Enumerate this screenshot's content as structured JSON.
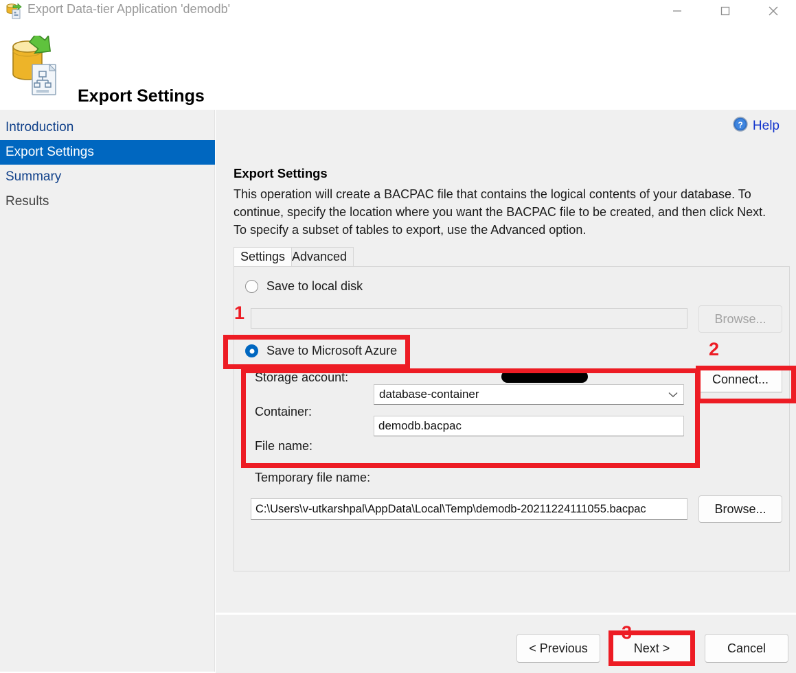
{
  "window": {
    "title": "Export Data-tier Application 'demodb'",
    "icon": "export-dac-icon",
    "controls": {
      "minimize": "minimize-icon",
      "maximize": "maximize-icon",
      "close": "close-icon"
    }
  },
  "header": {
    "title": "Export Settings",
    "icon": "database-export-icon"
  },
  "sidebar": {
    "items": [
      {
        "label": "Introduction",
        "state": "link"
      },
      {
        "label": "Export Settings",
        "state": "active"
      },
      {
        "label": "Summary",
        "state": "link"
      },
      {
        "label": "Results",
        "state": "muted"
      }
    ]
  },
  "main": {
    "help": {
      "label": "Help",
      "icon": "help-circle-icon"
    },
    "section_title": "Export Settings",
    "description": "This operation will create a BACPAC file that contains the logical contents of your database. To continue, specify the location where you want the BACPAC file to be created, and then click Next. To specify a subset of tables to export, use the Advanced option.",
    "tabs": [
      {
        "label": "Settings",
        "active": true
      },
      {
        "label": "Advanced",
        "active": false
      }
    ],
    "local_disk": {
      "radio_label": "Save to local disk",
      "selected": false,
      "path_value": "",
      "path_placeholder": "",
      "browse_label": "Browse...",
      "browse_enabled": false
    },
    "azure": {
      "radio_label": "Save to Microsoft Azure",
      "selected": true,
      "storage_account_label": "Storage account:",
      "storage_account_value": "",
      "storage_account_redacted": true,
      "container_label": "Container:",
      "container_value": "database-container",
      "container_caret": "chevron-down-icon",
      "file_name_label": "File name:",
      "file_name_value": "demodb.bacpac",
      "connect_label": "Connect..."
    },
    "temp_file": {
      "label": "Temporary file name:",
      "value": "C:\\Users\\v-utkarshpal\\AppData\\Local\\Temp\\demodb-20211224111055.bacpac",
      "browse_label": "Browse..."
    }
  },
  "footer": {
    "previous_label": "< Previous",
    "next_label": "Next >",
    "cancel_label": "Cancel"
  },
  "annotations": {
    "markers": [
      "1",
      "2",
      "3"
    ],
    "color": "#ed1c24"
  },
  "colors": {
    "accent_blue": "#0067c0",
    "link_blue": "#11418a",
    "annotation_red": "#ed1c24",
    "window_bg": "#f0f0f0"
  }
}
